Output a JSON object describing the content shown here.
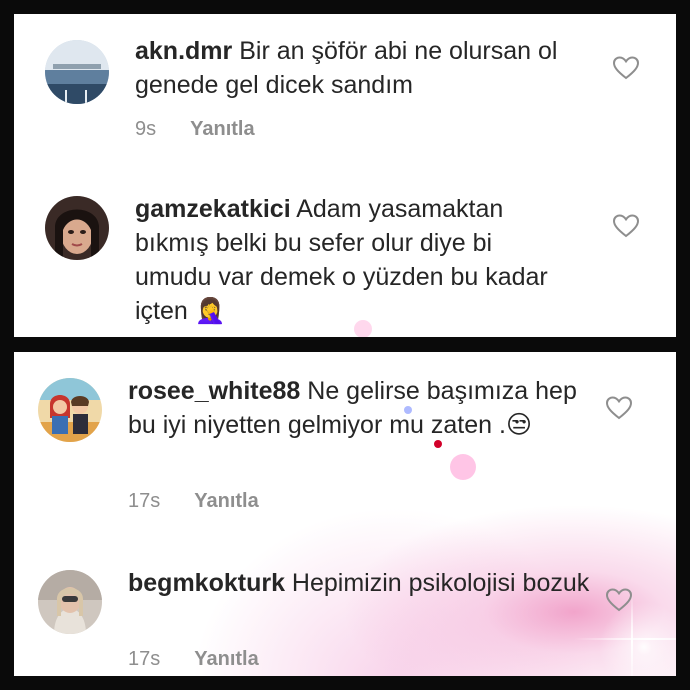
{
  "comments_top": [
    {
      "username": "akn.dmr",
      "text": " Bir an şöför abi ne olursan ol genede gel dicek sandım",
      "time": "9s",
      "reply_label": "Yanıtla"
    },
    {
      "username": "gamzekatkici",
      "text": " Adam yasamaktan bıkmış belki bu sefer olur diye bi umudu var demek o yüzden bu kadar içten 🤦‍♀",
      "time": "",
      "reply_label": ""
    }
  ],
  "comments_bottom": [
    {
      "username": "rosee_white88",
      "text": " Ne gelirse başımıza hep bu iyi niyetten gelmiyor mu zaten .😒",
      "time": "17s",
      "reply_label": "Yanıtla"
    },
    {
      "username": "begmkokturk",
      "text": " Hepimizin psikolojisi bozuk",
      "time": "17s",
      "reply_label": "Yanıtla"
    }
  ],
  "icons": {
    "like": "heart-outline-icon"
  },
  "colors": {
    "text": "#262626",
    "meta": "#8e8e8e",
    "background_frame": "#0a0a0a",
    "pink_accent": "#e65aa0"
  }
}
